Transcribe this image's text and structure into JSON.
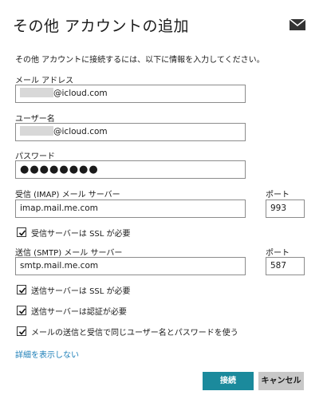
{
  "dialog": {
    "title": "その他 アカウントの追加",
    "intro": "その他 アカウントに接続するには、以下に情報を入力してください。"
  },
  "fields": {
    "email": {
      "label": "メール アドレス",
      "value_suffix": "@icloud.com"
    },
    "username": {
      "label": "ユーザー名",
      "value_suffix": "@icloud.com"
    },
    "password": {
      "label": "パスワード",
      "value": "●●●●●●●●"
    },
    "incoming_server": {
      "label": "受信 (IMAP) メール サーバー",
      "value": "imap.mail.me.com"
    },
    "incoming_port": {
      "label": "ポート",
      "value": "993"
    },
    "outgoing_server": {
      "label": "送信 (SMTP) メール サーバー",
      "value": "smtp.mail.me.com"
    },
    "outgoing_port": {
      "label": "ポート",
      "value": "587"
    }
  },
  "checkboxes": [
    {
      "label": "受信サーバーは SSL が必要",
      "checked": true
    },
    {
      "label": "送信サーバーは SSL が必要",
      "checked": true
    },
    {
      "label": "送信サーバーは認証が必要",
      "checked": true
    },
    {
      "label": "メールの送信と受信で同じユーザー名とパスワードを使う",
      "checked": true
    }
  ],
  "links": {
    "hide_details": "詳細を表示しない"
  },
  "buttons": {
    "connect": "接続",
    "cancel": "キャンセル"
  },
  "colors": {
    "accent": "#1b8a9c",
    "link": "#1e7fb8",
    "cancel_bg": "#c8c8c8"
  },
  "icons": {
    "header": "mail-icon",
    "checkbox": "checkmark-icon"
  }
}
